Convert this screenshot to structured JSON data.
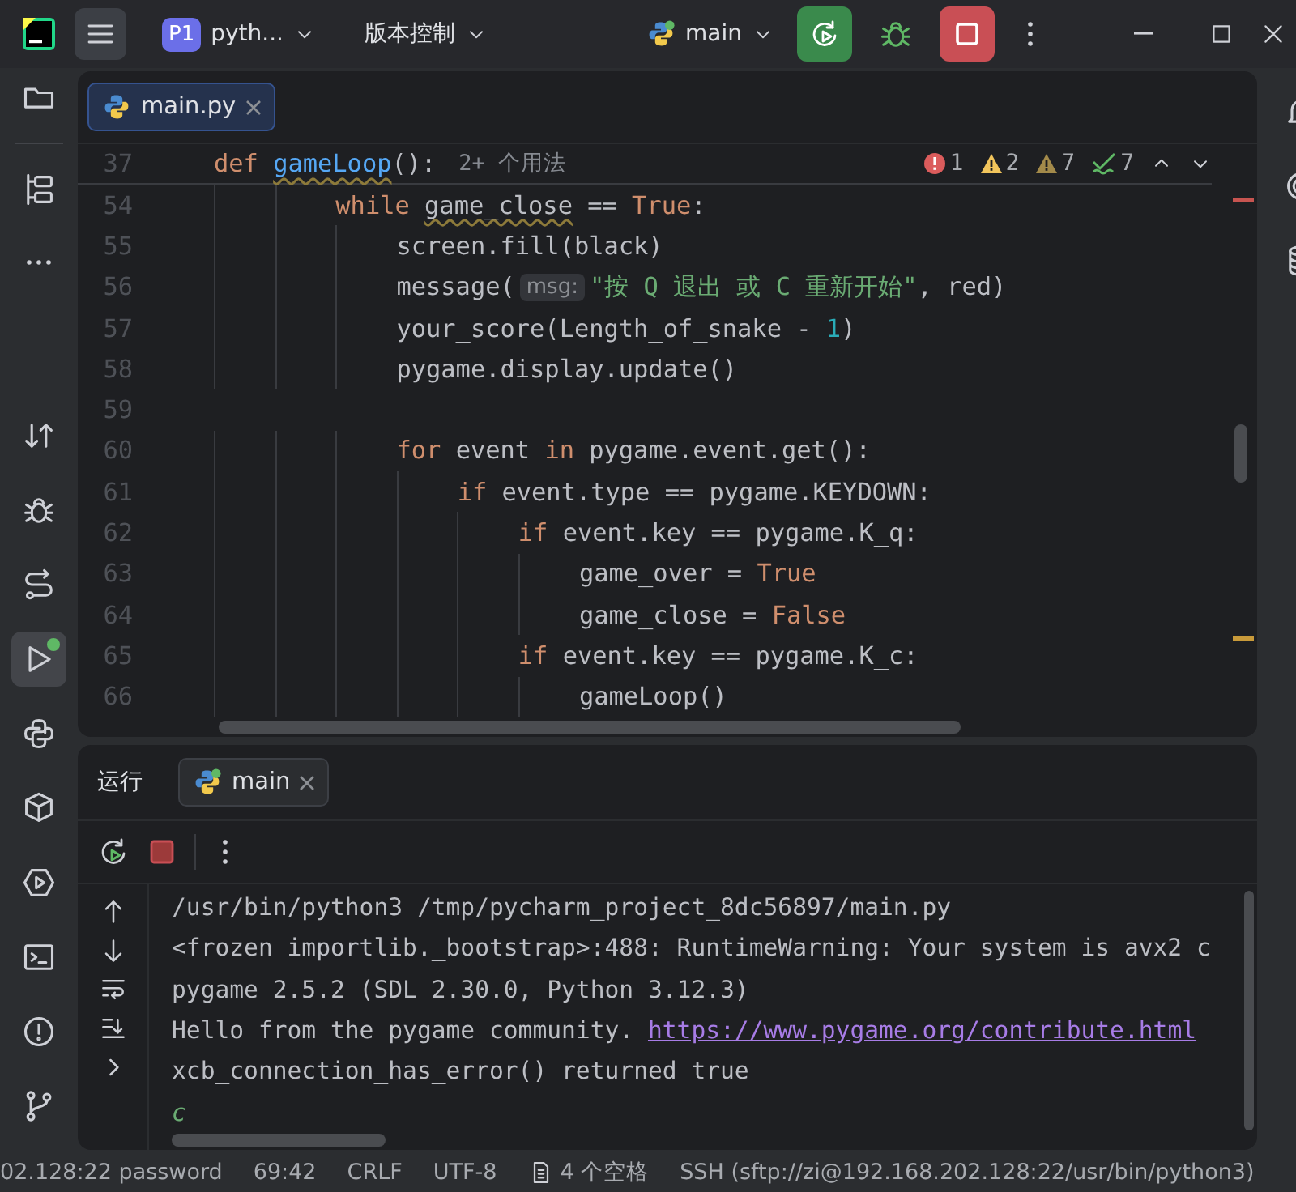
{
  "title_bar": {
    "project_badge": "P1",
    "project_name": "pyth...",
    "vcs_menu": "版本控制",
    "run_config": "main"
  },
  "left_toolbar": {
    "top": [
      {
        "kind": "folder",
        "selected": false
      },
      {
        "kind": "structure",
        "selected": false
      },
      {
        "kind": "more",
        "selected": false
      }
    ],
    "bottom": [
      {
        "kind": "commit",
        "selected": false
      },
      {
        "kind": "debug",
        "selected": false
      },
      {
        "kind": "endpoints",
        "selected": false
      },
      {
        "kind": "run",
        "selected": true
      },
      {
        "kind": "python",
        "selected": false
      },
      {
        "kind": "packages",
        "selected": false
      },
      {
        "kind": "services",
        "selected": false
      },
      {
        "kind": "terminal",
        "selected": false
      },
      {
        "kind": "problems",
        "selected": false
      },
      {
        "kind": "git",
        "selected": false
      }
    ]
  },
  "right_toolbar": [
    {
      "kind": "bell"
    },
    {
      "kind": "ai"
    },
    {
      "kind": "database"
    }
  ],
  "editor": {
    "tabs": [
      {
        "label": "main.py",
        "selected": true
      }
    ],
    "sticky_line": {
      "number": "37",
      "tokens": [
        {
          "kind": "kw",
          "text": "def "
        },
        {
          "kind": "fn_warn",
          "text": "gameLoop"
        },
        {
          "kind": "plain",
          "text": "():"
        }
      ],
      "usages": "2+ 个用法"
    },
    "inspections": [
      {
        "kind": "error",
        "count": "1"
      },
      {
        "kind": "warning",
        "count": "2"
      },
      {
        "kind": "weak_warning",
        "count": "7"
      },
      {
        "kind": "typo",
        "count": "7"
      }
    ],
    "lines": [
      {
        "number": "54",
        "tokens": [
          {
            "kind": "kw",
            "text": "        while "
          },
          {
            "kind": "warn",
            "text": "game_close"
          },
          {
            "kind": "plain",
            "text": " == "
          },
          {
            "kind": "kw",
            "text": "True"
          },
          {
            "kind": "plain",
            "text": ":"
          }
        ]
      },
      {
        "number": "55",
        "tokens": [
          {
            "kind": "plain",
            "text": "            screen.fill(black)"
          }
        ]
      },
      {
        "number": "56",
        "tokens": [
          {
            "kind": "plain",
            "text": "            message("
          },
          {
            "kind": "hint",
            "text": "msg:"
          },
          {
            "kind": "str",
            "text": "\"按 Q 退出 或 C 重新开始\""
          },
          {
            "kind": "plain",
            "text": ", red)"
          }
        ]
      },
      {
        "number": "57",
        "tokens": [
          {
            "kind": "plain",
            "text": "            your_score(Length_of_snake - "
          },
          {
            "kind": "num",
            "text": "1"
          },
          {
            "kind": "plain",
            "text": ")"
          }
        ]
      },
      {
        "number": "58",
        "tokens": [
          {
            "kind": "plain",
            "text": "            pygame.display.update()"
          }
        ]
      },
      {
        "number": "59"
      },
      {
        "number": "60",
        "tokens": [
          {
            "kind": "kw",
            "text": "            for"
          },
          {
            "kind": "plain",
            "text": " event "
          },
          {
            "kind": "kw",
            "text": "in"
          },
          {
            "kind": "plain",
            "text": " pygame.event.get():"
          }
        ]
      },
      {
        "number": "61",
        "tokens": [
          {
            "kind": "kw",
            "text": "                if"
          },
          {
            "kind": "plain",
            "text": " event.type == pygame.KEYDOWN:"
          }
        ]
      },
      {
        "number": "62",
        "tokens": [
          {
            "kind": "kw",
            "text": "                    if"
          },
          {
            "kind": "plain",
            "text": " event.key == pygame.K_q:"
          }
        ]
      },
      {
        "number": "63",
        "tokens": [
          {
            "kind": "plain",
            "text": "                        game_over = "
          },
          {
            "kind": "kw",
            "text": "True"
          }
        ]
      },
      {
        "number": "64",
        "tokens": [
          {
            "kind": "plain",
            "text": "                        game_close = "
          },
          {
            "kind": "kw",
            "text": "False"
          }
        ]
      },
      {
        "number": "65",
        "tokens": [
          {
            "kind": "kw",
            "text": "                    if"
          },
          {
            "kind": "plain",
            "text": " event.key == pygame.K_c:"
          }
        ]
      },
      {
        "number": "66",
        "tokens": [
          {
            "kind": "plain",
            "text": "                        gameLoop()"
          }
        ]
      }
    ]
  },
  "run_panel": {
    "title": "运行",
    "tabs": [
      {
        "label": "main",
        "selected": true
      }
    ],
    "console": [
      {
        "segments": [
          {
            "kind": "text",
            "text": "/usr/bin/python3 /tmp/pycharm_project_8dc56897/main.py"
          }
        ]
      },
      {
        "segments": [
          {
            "kind": "text",
            "text": "<frozen importlib._bootstrap>:488: RuntimeWarning: Your system is avx2 c"
          }
        ]
      },
      {
        "segments": [
          {
            "kind": "text",
            "text": "pygame 2.5.2 (SDL 2.30.0, Python 3.12.3)"
          }
        ]
      },
      {
        "segments": [
          {
            "kind": "text",
            "text": "Hello from the pygame community. "
          },
          {
            "kind": "link",
            "text": "https://www.pygame.org/contribute.html"
          }
        ]
      },
      {
        "segments": [
          {
            "kind": "text",
            "text": "xcb_connection_has_error() returned true"
          }
        ]
      },
      {
        "segments": [
          {
            "kind": "input",
            "text": "c"
          }
        ]
      }
    ]
  },
  "status_bar": [
    {
      "kind": "text",
      "text": "02.128:22 password"
    },
    {
      "kind": "text",
      "text": "69:42"
    },
    {
      "kind": "text",
      "text": "CRLF"
    },
    {
      "kind": "text",
      "text": "UTF-8"
    },
    {
      "kind": "indent",
      "text": "4 个空格"
    },
    {
      "kind": "text",
      "text": "SSH (sftp://zi@192.168.202.128:22/usr/bin/python3)"
    }
  ]
}
